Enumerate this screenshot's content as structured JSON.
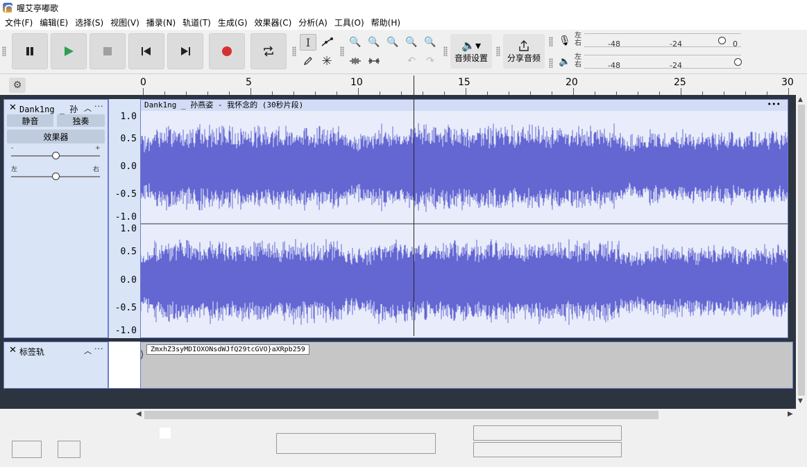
{
  "window": {
    "title": "喔艾亭嘟歌"
  },
  "menu": [
    "文件(F)",
    "编辑(E)",
    "选择(S)",
    "视图(V)",
    "播录(N)",
    "轨道(T)",
    "生成(G)",
    "效果器(C)",
    "分析(A)",
    "工具(O)",
    "帮助(H)"
  ],
  "toolbar": {
    "audio_setup_label": "音频设置",
    "share_audio_label": "分享音频"
  },
  "meters": {
    "left": "左",
    "right": "右",
    "tick_48": "-48",
    "tick_24": "-24",
    "tick_0": "0"
  },
  "timeline": {
    "labels": [
      "0",
      "5",
      "10",
      "15",
      "20",
      "25",
      "30"
    ]
  },
  "audio_track": {
    "name": "Dank1ng _ 孙",
    "mute_label": "静音",
    "solo_label": "独奏",
    "effects_label": "效果器",
    "gain_minus": "-",
    "gain_plus": "+",
    "pan_left": "左",
    "pan_right": "右",
    "gain": 0.5,
    "pan": 0.5,
    "clip_title": "Dank1ng _ 孙燕姿 - 我怀念的 (30秒片段)",
    "scale_labels": [
      "1.0",
      "0.5",
      "0.0",
      "-0.5",
      "-1.0"
    ]
  },
  "label_track": {
    "name": "标签轨",
    "label_text": "ZmxhZ3syMDIOXONsdWJfQ29tcGVO}aXRpb259"
  },
  "colors": {
    "waveform": "#6466d2",
    "waveform_bg": "#e9edfb",
    "track_panel": "#d9e4f6",
    "record_red": "#d83030",
    "play_green": "#2f9e4f"
  }
}
